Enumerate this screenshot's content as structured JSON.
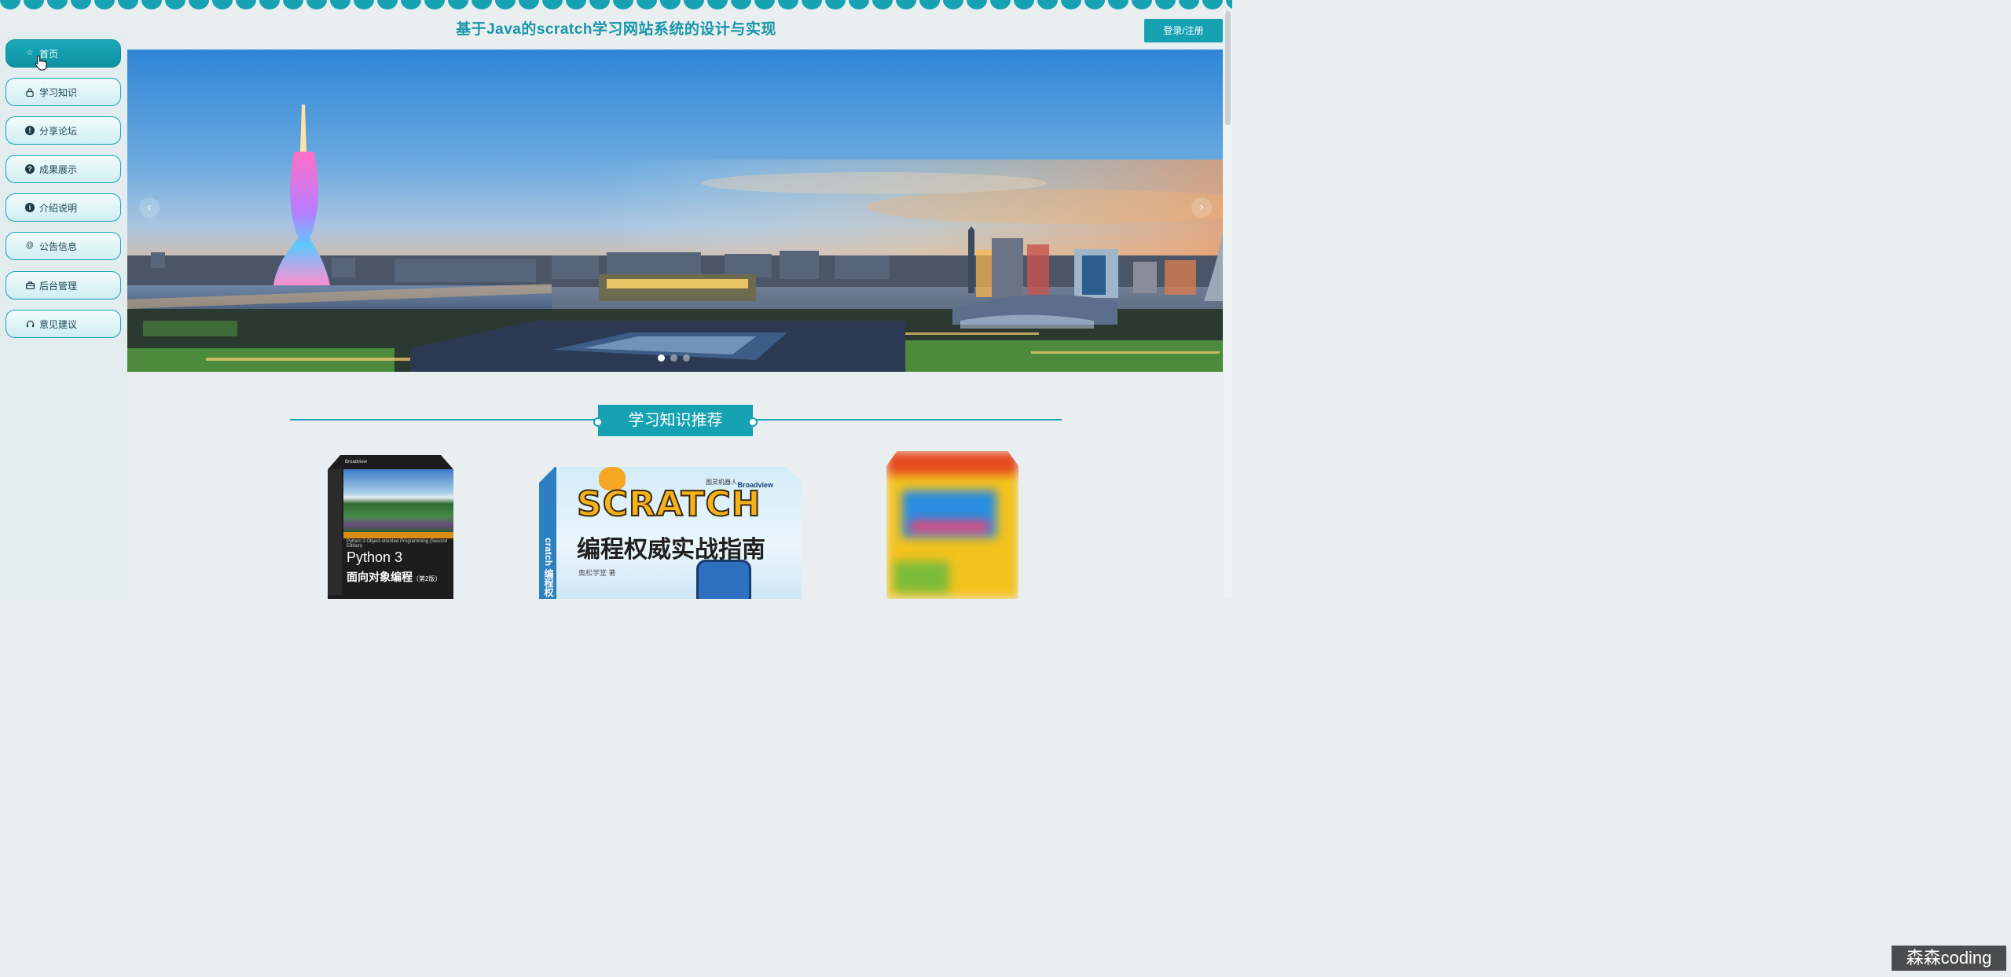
{
  "header": {
    "title": "基于Java的scratch学习网站系统的设计与实现",
    "login_label": "登录/注册"
  },
  "sidebar": {
    "items": [
      {
        "label": "首页",
        "icon": "star-icon",
        "active": true
      },
      {
        "label": "学习知识",
        "icon": "lock-icon",
        "active": false
      },
      {
        "label": "分享论坛",
        "icon": "alert-icon",
        "active": false
      },
      {
        "label": "成果展示",
        "icon": "question-icon",
        "active": false
      },
      {
        "label": "介绍说明",
        "icon": "info-icon",
        "active": false
      },
      {
        "label": "公告信息",
        "icon": "at-icon",
        "active": false
      },
      {
        "label": "后台管理",
        "icon": "briefcase-icon",
        "active": false
      },
      {
        "label": "意见建议",
        "icon": "headset-icon",
        "active": false
      }
    ]
  },
  "carousel": {
    "slide_count": 3,
    "active_index": 0,
    "prev_icon": "chevron-left-icon",
    "next_icon": "chevron-right-icon"
  },
  "section": {
    "heading": "学习知识推荐"
  },
  "books": [
    {
      "publisher": "Broadview",
      "subtitle_en": "Python 3 Object-oriented Programming (Second Edition)",
      "title_line1": "Python 3",
      "title_line2": "面向对象编程",
      "edition": "（第2版）"
    },
    {
      "publisher_mark": "图灵机器人",
      "brand": "Broadview",
      "logo_word": "SCRATCH",
      "title": "编程权威实战指南",
      "author": "奥松学堂 著",
      "spine": "cratch 编程权"
    },
    {
      "blurred": true
    }
  ],
  "watermark": "森森coding",
  "colors": {
    "accent": "#16a2b3",
    "title": "#1795a8",
    "sidebar_bg": "#e3edef"
  }
}
